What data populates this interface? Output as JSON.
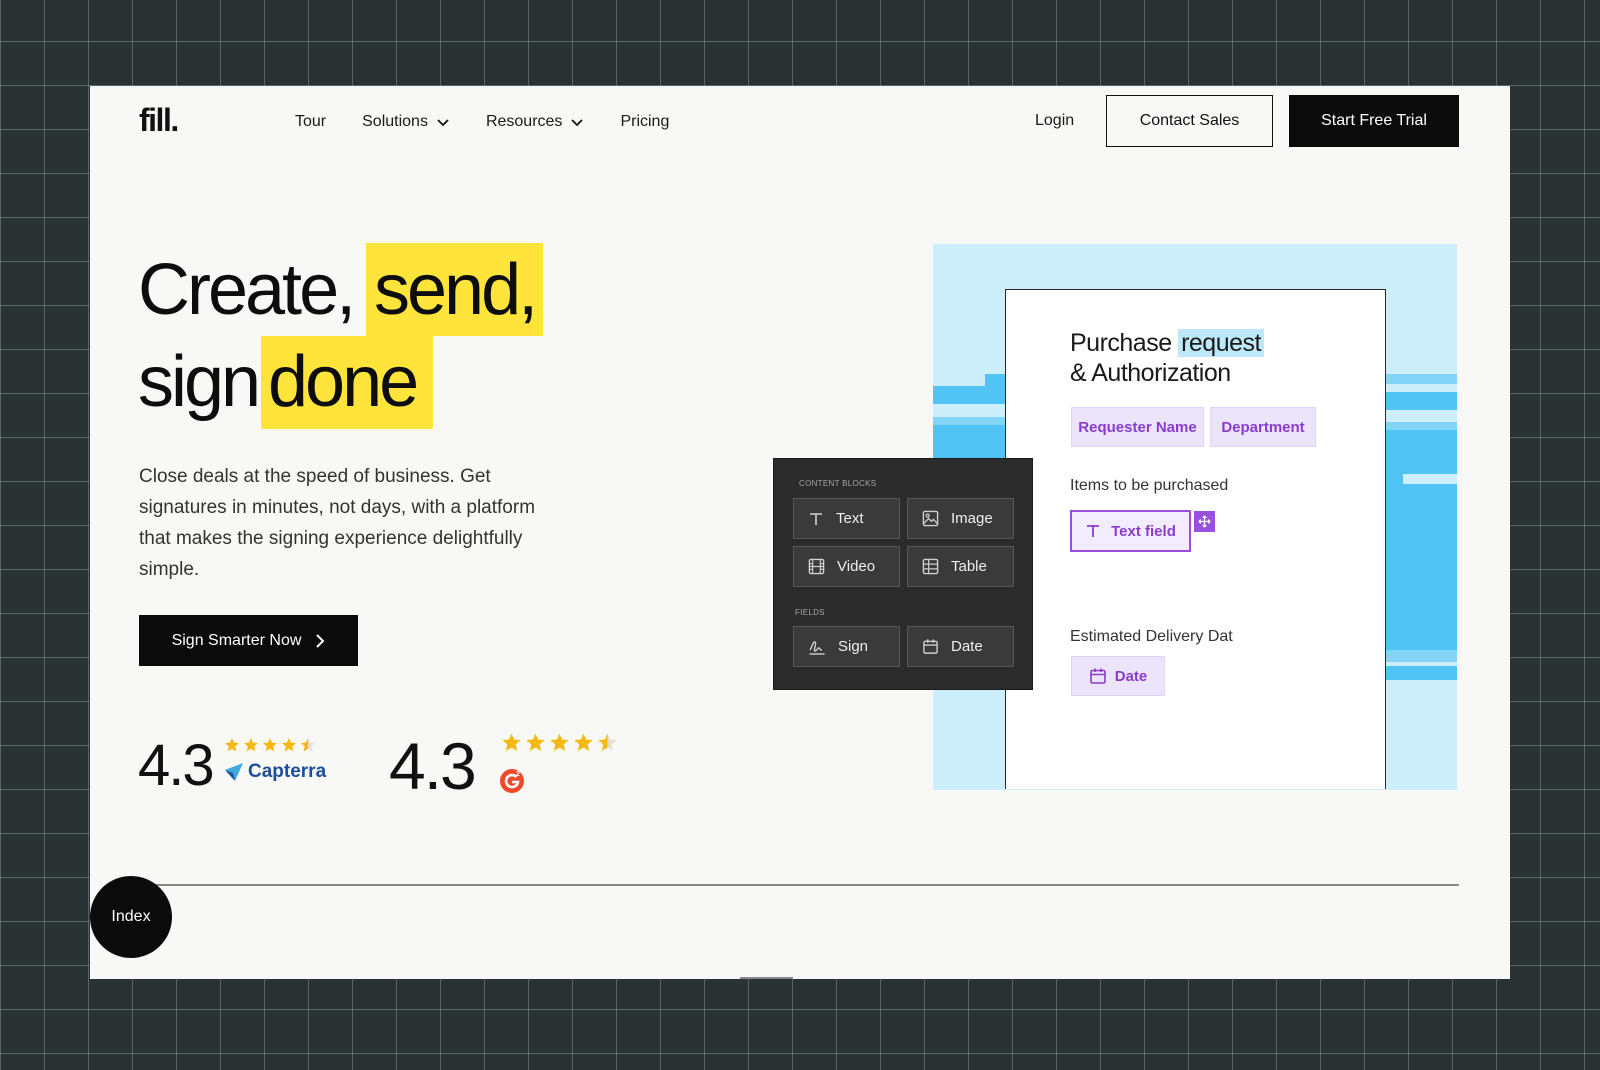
{
  "brand": {
    "logo": "fill."
  },
  "nav": {
    "items": [
      {
        "label": "Tour",
        "has_dropdown": false
      },
      {
        "label": "Solutions",
        "has_dropdown": true
      },
      {
        "label": "Resources",
        "has_dropdown": true
      },
      {
        "label": "Pricing",
        "has_dropdown": false
      }
    ],
    "login": "Login",
    "contact_sales": "Contact Sales",
    "start_trial": "Start Free Trial"
  },
  "hero": {
    "line1_plain": "Create,",
    "line1_highlight": "send,",
    "line2_plain": "sign",
    "line2_highlight": "done",
    "highlight_color": "#ffe53b",
    "description": "Close deals at the speed of business. Get signatures in minutes, not days, with a platform that makes the signing experience delightfully simple.",
    "cta": "Sign Smarter Now"
  },
  "ratings": [
    {
      "score": "4.3",
      "stars": 4.5,
      "source": "Capterra"
    },
    {
      "score": "4.3",
      "stars": 4.5,
      "source": "G2"
    }
  ],
  "document": {
    "title_plain": "Purchase",
    "title_highlight": "request",
    "title_line2": "& Authorization",
    "chips": [
      "Requester Name",
      "Department"
    ],
    "items_label": "Items to be purchased",
    "text_field": "Text field",
    "delivery_label": "Estimated Delivery Dat",
    "date_chip": "Date"
  },
  "blocks_panel": {
    "content_label": "CONTENT BLOCKS",
    "content_blocks": [
      "Text",
      "Image",
      "Video",
      "Table"
    ],
    "fields_label": "FIELDS",
    "fields": [
      "Sign",
      "Date"
    ]
  },
  "index_button": "Index",
  "colors": {
    "accent_purple": "#9a4fe0",
    "sky": "#cdeefb",
    "sky_strong": "#52c3f5",
    "star": "#f5b916"
  },
  "icons": [
    "chevron-down-icon",
    "chevron-right-icon",
    "star-icon",
    "capterra-logo-icon",
    "g2-logo-icon",
    "text-icon",
    "image-icon",
    "video-icon",
    "table-icon",
    "signature-icon",
    "calendar-icon",
    "move-icon"
  ]
}
